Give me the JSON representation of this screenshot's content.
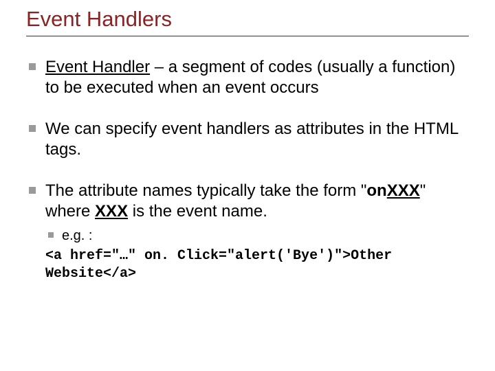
{
  "title": "Event Handlers",
  "bullets": {
    "b1": {
      "term": "Event Handler",
      "rest": " – a segment of codes (usually a function) to be executed when an event occurs"
    },
    "b2": "We can specify event handlers as attributes in the HTML tags.",
    "b3": {
      "pre": "The attribute names typically take the form \"",
      "onkw": "on",
      "mid1": "XXX",
      "mid2": "\" where ",
      "mid3": "XXX",
      "post": " is the event name.",
      "eg": "e.g. :",
      "code": "<a href=\"…\" on. Click=\"alert('Bye')\">Other Website</a>"
    }
  }
}
